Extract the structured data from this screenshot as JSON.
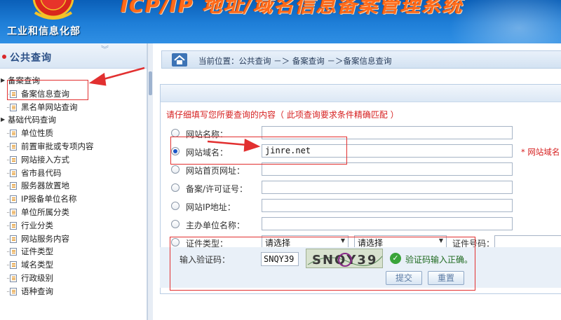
{
  "header": {
    "system_title": "ICP/IP 地址/域名信息备案管理系统",
    "ministry": "工业和信息化部",
    "emblem": "national-emblem-icon"
  },
  "sidebar": {
    "title": "公共查询",
    "collapse_icon": "double-chevron-down-icon",
    "groups": [
      {
        "label": "备案查询",
        "items": [
          "备案信息查询",
          "黑名单网站查询"
        ]
      },
      {
        "label": "基础代码查询",
        "items": [
          "单位性质",
          "前置审批或专项内容",
          "网站接入方式",
          "省市县代码",
          "服务器放置地",
          "IP报备单位名称",
          "单位所属分类",
          "行业分类",
          "网站服务内容",
          "证件类型",
          "域名类型",
          "行政级别",
          "语种查询"
        ]
      }
    ]
  },
  "breadcrumb": {
    "text": "当前位置：公共查询   －＞  备案查询  －＞备案信息查询"
  },
  "form": {
    "instruction": "请仔细填写您所要查询的内容（ 此项查询要求条件精确匹配 ）",
    "fields": [
      {
        "label": "网站名称：",
        "value": "",
        "selected": false
      },
      {
        "label": "网站域名：",
        "value": "jinre.net",
        "selected": true
      },
      {
        "label": "网站首页网址：",
        "value": "",
        "selected": false
      },
      {
        "label": "备案/许可证号：",
        "value": "",
        "selected": false
      },
      {
        "label": "网站IP地址：",
        "value": "",
        "selected": false
      },
      {
        "label": "主办单位名称：",
        "value": "",
        "selected": false
      }
    ],
    "required_note": "* 网站域名",
    "cert": {
      "label": "证件类型：",
      "select1": "请选择",
      "select2": "请选择",
      "number_label": "证件号码："
    },
    "captcha": {
      "label": "输入验证码：",
      "value": "SNQY39",
      "image_text": "SNQY39",
      "ok_icon": "check-circle-icon",
      "message": "验证码输入正确。"
    },
    "buttons": {
      "submit": "提交",
      "reset": "重置"
    }
  },
  "colors": {
    "header_blue": "#1f7fd8",
    "title_orange": "#ff6a1a",
    "required_red": "#d62020",
    "annotation_red": "#e23030"
  }
}
